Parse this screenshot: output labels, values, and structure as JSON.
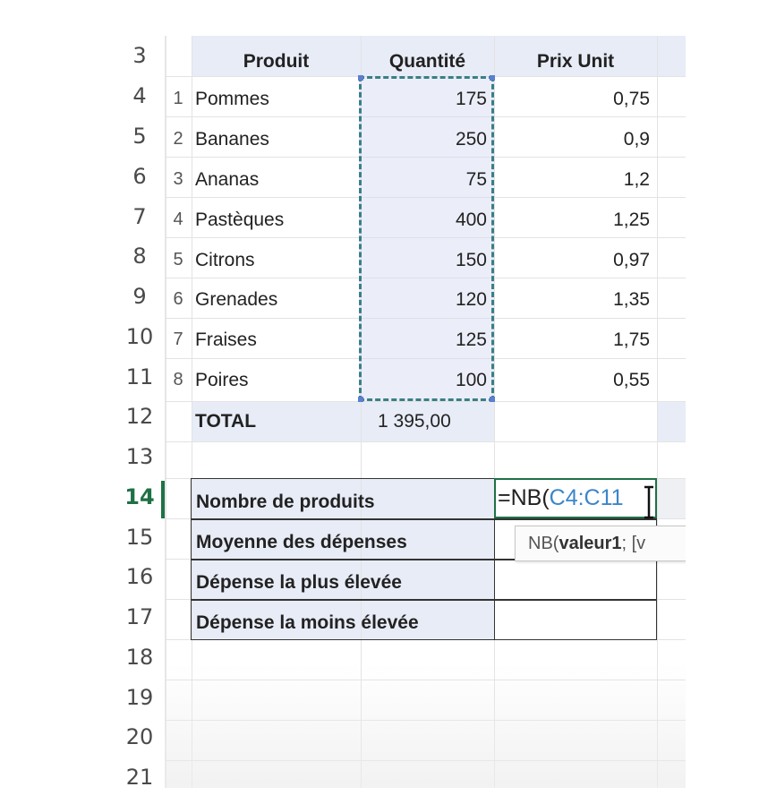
{
  "rows": [
    {
      "num": "3"
    },
    {
      "num": "4"
    },
    {
      "num": "5"
    },
    {
      "num": "6"
    },
    {
      "num": "7"
    },
    {
      "num": "8"
    },
    {
      "num": "9"
    },
    {
      "num": "10"
    },
    {
      "num": "11"
    },
    {
      "num": "12"
    },
    {
      "num": "13"
    },
    {
      "num": "14"
    },
    {
      "num": "15"
    },
    {
      "num": "16"
    },
    {
      "num": "17"
    },
    {
      "num": "18"
    },
    {
      "num": "19"
    },
    {
      "num": "20"
    },
    {
      "num": "21"
    }
  ],
  "table": {
    "headers": {
      "produit": "Produit",
      "quantite": "Quantité",
      "prix": "Prix Unit"
    },
    "items": [
      {
        "idx": "1",
        "name": "Pommes",
        "qty": "175",
        "price": "0,75"
      },
      {
        "idx": "2",
        "name": "Bananes",
        "qty": "250",
        "price": "0,9"
      },
      {
        "idx": "3",
        "name": "Ananas",
        "qty": "75",
        "price": "1,2"
      },
      {
        "idx": "4",
        "name": "Pastèques",
        "qty": "400",
        "price": "1,25"
      },
      {
        "idx": "5",
        "name": "Citrons",
        "qty": "150",
        "price": "0,97"
      },
      {
        "idx": "6",
        "name": "Grenades",
        "qty": "120",
        "price": "1,35"
      },
      {
        "idx": "7",
        "name": "Fraises",
        "qty": "125",
        "price": "1,75"
      },
      {
        "idx": "8",
        "name": "Poires",
        "qty": "100",
        "price": "0,55"
      }
    ],
    "total_label": "TOTAL",
    "total_value": "1 395,00"
  },
  "stats": [
    {
      "label": "Nombre de produits"
    },
    {
      "label": "Moyenne des dépenses"
    },
    {
      "label": "Dépense la plus élevée"
    },
    {
      "label": "Dépense la moins élevée"
    }
  ],
  "editing": {
    "prefix": "=NB(",
    "range": "C4:C11",
    "tooltip_fn": "NB(",
    "tooltip_arg": "valeur1",
    "tooltip_rest": "; [v"
  },
  "colors": {
    "active_row": "#1e7145",
    "selection_border": "#3a7f86",
    "formula_ref": "#3b86c9",
    "fill_band": "#e8ecf7"
  }
}
